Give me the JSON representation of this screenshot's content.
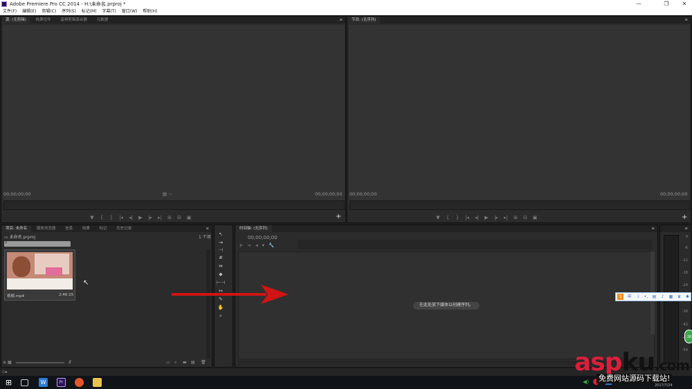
{
  "window": {
    "title": "Adobe Premiere Pro CC 2014 - H:\\未命名.prproj *",
    "minimize": "—",
    "maximize": "❐",
    "close": "✕"
  },
  "menu": [
    "文件(F)",
    "编辑(E)",
    "剪辑(C)",
    "序列(S)",
    "标记(M)",
    "字幕(T)",
    "窗口(W)",
    "帮助(H)"
  ],
  "source_monitor": {
    "tabs": [
      "源: (无剪辑)",
      "效果控件",
      "音频剪辑混合器",
      "元数据"
    ],
    "timecode_left": "00;00;00;00",
    "timecode_right": "00;00;00;00"
  },
  "program_monitor": {
    "tabs": [
      "节目: (无序列)"
    ],
    "timecode_left": "00;00;00;00",
    "timecode_right": "00;00;00;00"
  },
  "project": {
    "tabs": [
      "项目: 未命名",
      "媒体浏览器",
      "信息",
      "效果",
      "标记",
      "历史记录"
    ],
    "file": "未命名.prproj",
    "count": "1 个项",
    "clip_name": "视频.mp4",
    "clip_duration": "2:46:15"
  },
  "timeline": {
    "tab": "时间轴: (无序列)",
    "timecode": "00;00;00;00",
    "hint": "在此处放下媒体以创建序列。"
  },
  "meters": {
    "scale": [
      "0",
      "-6",
      "-12",
      "-18",
      "-24",
      "-30",
      "-36",
      "-42",
      "-48",
      "-54"
    ]
  },
  "ime": {
    "label": "中"
  },
  "taskbar": {
    "tray_number": "26",
    "date": "2017/7/24"
  },
  "watermark": {
    "brand_asp": "asp",
    "brand_ku": "ku",
    "brand_com": ".com",
    "tagline": "免费网站源码下载站!"
  },
  "colors": {
    "panel": "#2b2b2b",
    "arrow": "#d01414",
    "brand_red": "#d8203a"
  }
}
